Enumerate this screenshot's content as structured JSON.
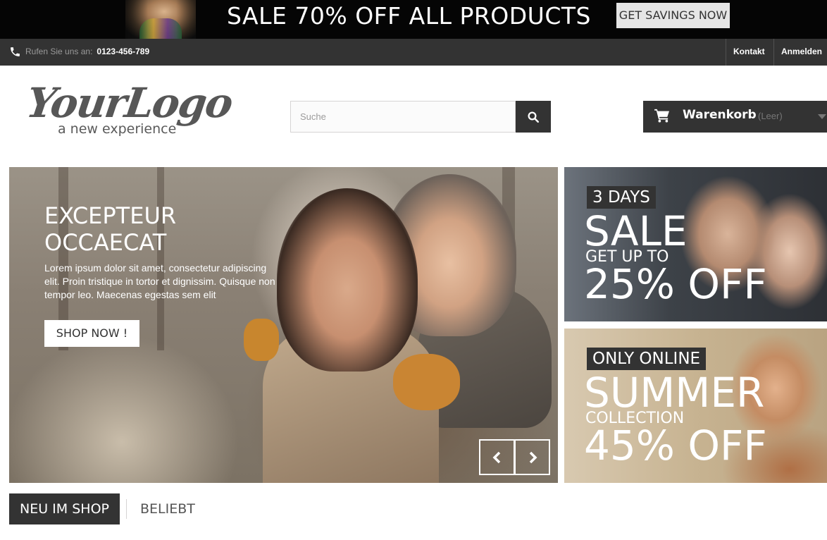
{
  "promo": {
    "headline": "SALE 70% OFF ALL PRODUCTS",
    "button_label": "GET SAVINGS NOW"
  },
  "navbar": {
    "phone_label": "Rufen Sie uns an:",
    "phone_number": "0123-456-789",
    "contact_label": "Kontakt",
    "login_label": "Anmelden"
  },
  "header": {
    "logo_text": "YourLogo",
    "logo_tagline": "a new experience",
    "search_placeholder": "Suche",
    "cart_label": "Warenkorb",
    "cart_status": "(Leer)"
  },
  "slider": {
    "title": "EXCEPTEUR\nOCCAECAT",
    "text": "Lorem ipsum dolor sit amet, consectetur adipiscing elit. Proin tristique in tortor et dignissim. Quisque non tempor leo. Maecenas egestas sem elit",
    "button_label": "SHOP NOW !"
  },
  "banners": [
    {
      "tag": "3 DAYS",
      "big": "SALE",
      "mid": "GET UP TO",
      "offer": "25% OFF"
    },
    {
      "tag": "ONLY ONLINE",
      "big": "SUMMER",
      "mid": "COLLECTION",
      "offer": "45% OFF"
    }
  ],
  "tabs": [
    {
      "label": "NEU IM SHOP",
      "active": true
    },
    {
      "label": "BELIEBT",
      "active": false
    }
  ],
  "colors": {
    "dark": "#333333",
    "black": "#050505",
    "white": "#ffffff",
    "light_button": "#e5e5e5"
  }
}
